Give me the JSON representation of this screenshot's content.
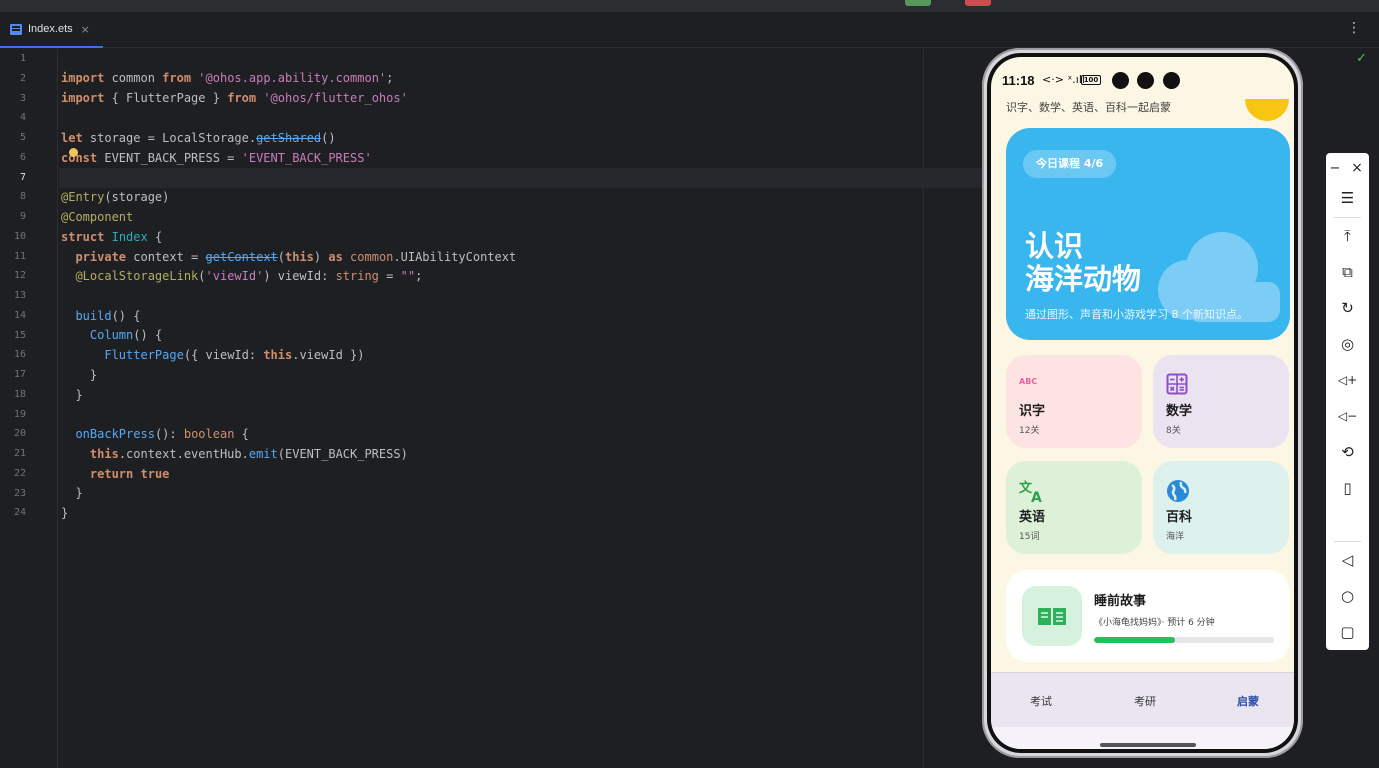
{
  "ide": {
    "tab": {
      "label": "Index.ets",
      "close": "×"
    },
    "menu_icon": "⋮",
    "status_icon": "✓",
    "line_numbers": [
      "1",
      "2",
      "3",
      "4",
      "5",
      "6",
      "7",
      "8",
      "9",
      "10",
      "11",
      "12",
      "13",
      "14",
      "15",
      "16",
      "17",
      "18",
      "19",
      "20",
      "21",
      "22",
      "23",
      "24"
    ],
    "active_line": "7"
  },
  "code": {
    "l2": {
      "k1": "import",
      "t1": " common ",
      "k2": "from",
      "t2": " ",
      "s1": "'@ohos.app.ability.common'",
      "t3": ";"
    },
    "l3": {
      "k1": "import",
      "t1": " { FlutterPage } ",
      "k2": "from",
      "t2": " ",
      "s1": "'@ohos/flutter_ohos'"
    },
    "l5": {
      "k1": "let",
      "t1": " storage = LocalStorage.",
      "f1": "getShared",
      "t2": "()"
    },
    "l6": {
      "k1": "const",
      "t1": " EVENT_BACK_PRESS = ",
      "s1": "'EVENT_BACK_PRESS'"
    },
    "l8": {
      "d1": "@Entry",
      "t1": "(storage)"
    },
    "l9": {
      "d1": "@Component"
    },
    "l10": {
      "k1": "struct",
      "t1": " ",
      "ty1": "Index",
      "t2": " {"
    },
    "l11": {
      "t0": "  ",
      "k1": "private",
      "t1": " context = ",
      "f1": "getContext",
      "t2": "(",
      "k2": "this",
      "t3": ") ",
      "k3": "as",
      "t4": " ",
      "ty1": "common",
      "t5": ".UIAbilityContext"
    },
    "l12": {
      "t0": "  ",
      "d1": "@LocalStorageLink",
      "t1": "(",
      "s1": "'viewId'",
      "t2": ") viewId: ",
      "k1": "string",
      "t3": " = ",
      "s2": "\"\"",
      "t4": ";"
    },
    "l14": {
      "t0": "  ",
      "f1": "build",
      "t1": "() {"
    },
    "l15": {
      "t0": "    ",
      "f1": "Column",
      "t1": "() {"
    },
    "l16": {
      "t0": "      ",
      "f1": "FlutterPage",
      "t1": "({ viewId: ",
      "k1": "this",
      "t2": ".viewId })"
    },
    "l17": {
      "t0": "    }"
    },
    "l18": {
      "t0": "  }"
    },
    "l20": {
      "t0": "  ",
      "f1": "onBackPress",
      "t1": "(): ",
      "k1": "boolean",
      "t2": " {"
    },
    "l21": {
      "t0": "    ",
      "k1": "this",
      "t1": ".context.eventHub.",
      "f1": "emit",
      "t2": "(EVENT_BACK_PRESS)"
    },
    "l22": {
      "t0": "    ",
      "k1": "return",
      "t1": " ",
      "k2": "true"
    },
    "l23": {
      "t0": "  }"
    },
    "l24": {
      "t0": "}"
    }
  },
  "phone": {
    "status": {
      "time": "11:18",
      "icons": "<·> ˣ.ıll",
      "battery": "100"
    },
    "subtitle": "识字、数学、英语、百科一起启蒙",
    "hero": {
      "badge": "今日课程 4/6",
      "title_line1": "认识",
      "title_line2": "海洋动物",
      "desc": "通过图形、声音和小游戏学习 8 个新知识点。"
    },
    "cards": [
      {
        "name": "识字",
        "sub": "12关",
        "icon": "ABC"
      },
      {
        "name": "数学",
        "sub": "8关",
        "icon": "calculator-icon"
      },
      {
        "name": "英语",
        "sub": "15词",
        "icon": "translate-icon"
      },
      {
        "name": "百科",
        "sub": "海洋",
        "icon": "globe-icon"
      }
    ],
    "story": {
      "title": "睡前故事",
      "desc": "《小海龟找妈妈》· 预计 6 分钟",
      "progress": 0.45
    },
    "nav": [
      {
        "label": "考试"
      },
      {
        "label": "考研"
      },
      {
        "label": "启蒙"
      }
    ]
  },
  "toolbar": {
    "minimize": "−",
    "close": "×",
    "menu": "☰",
    "top": "⤒",
    "crop": "⧉",
    "rotate": "↻",
    "screenshot": "◎",
    "vol_up": "◁+",
    "vol_down": "◁−",
    "shake": "⟲",
    "fold": "▯",
    "back": "◁",
    "home": "○",
    "recent": "▢"
  },
  "colors": {
    "hero": "#3ab6ef",
    "card_pink": "#fde4e2",
    "card_purple": "#ece3f1",
    "card_green": "#dcf1d8",
    "card_teal": "#dcf0ec",
    "progress": "#22c25b",
    "nav_active": "#2c4fae"
  }
}
